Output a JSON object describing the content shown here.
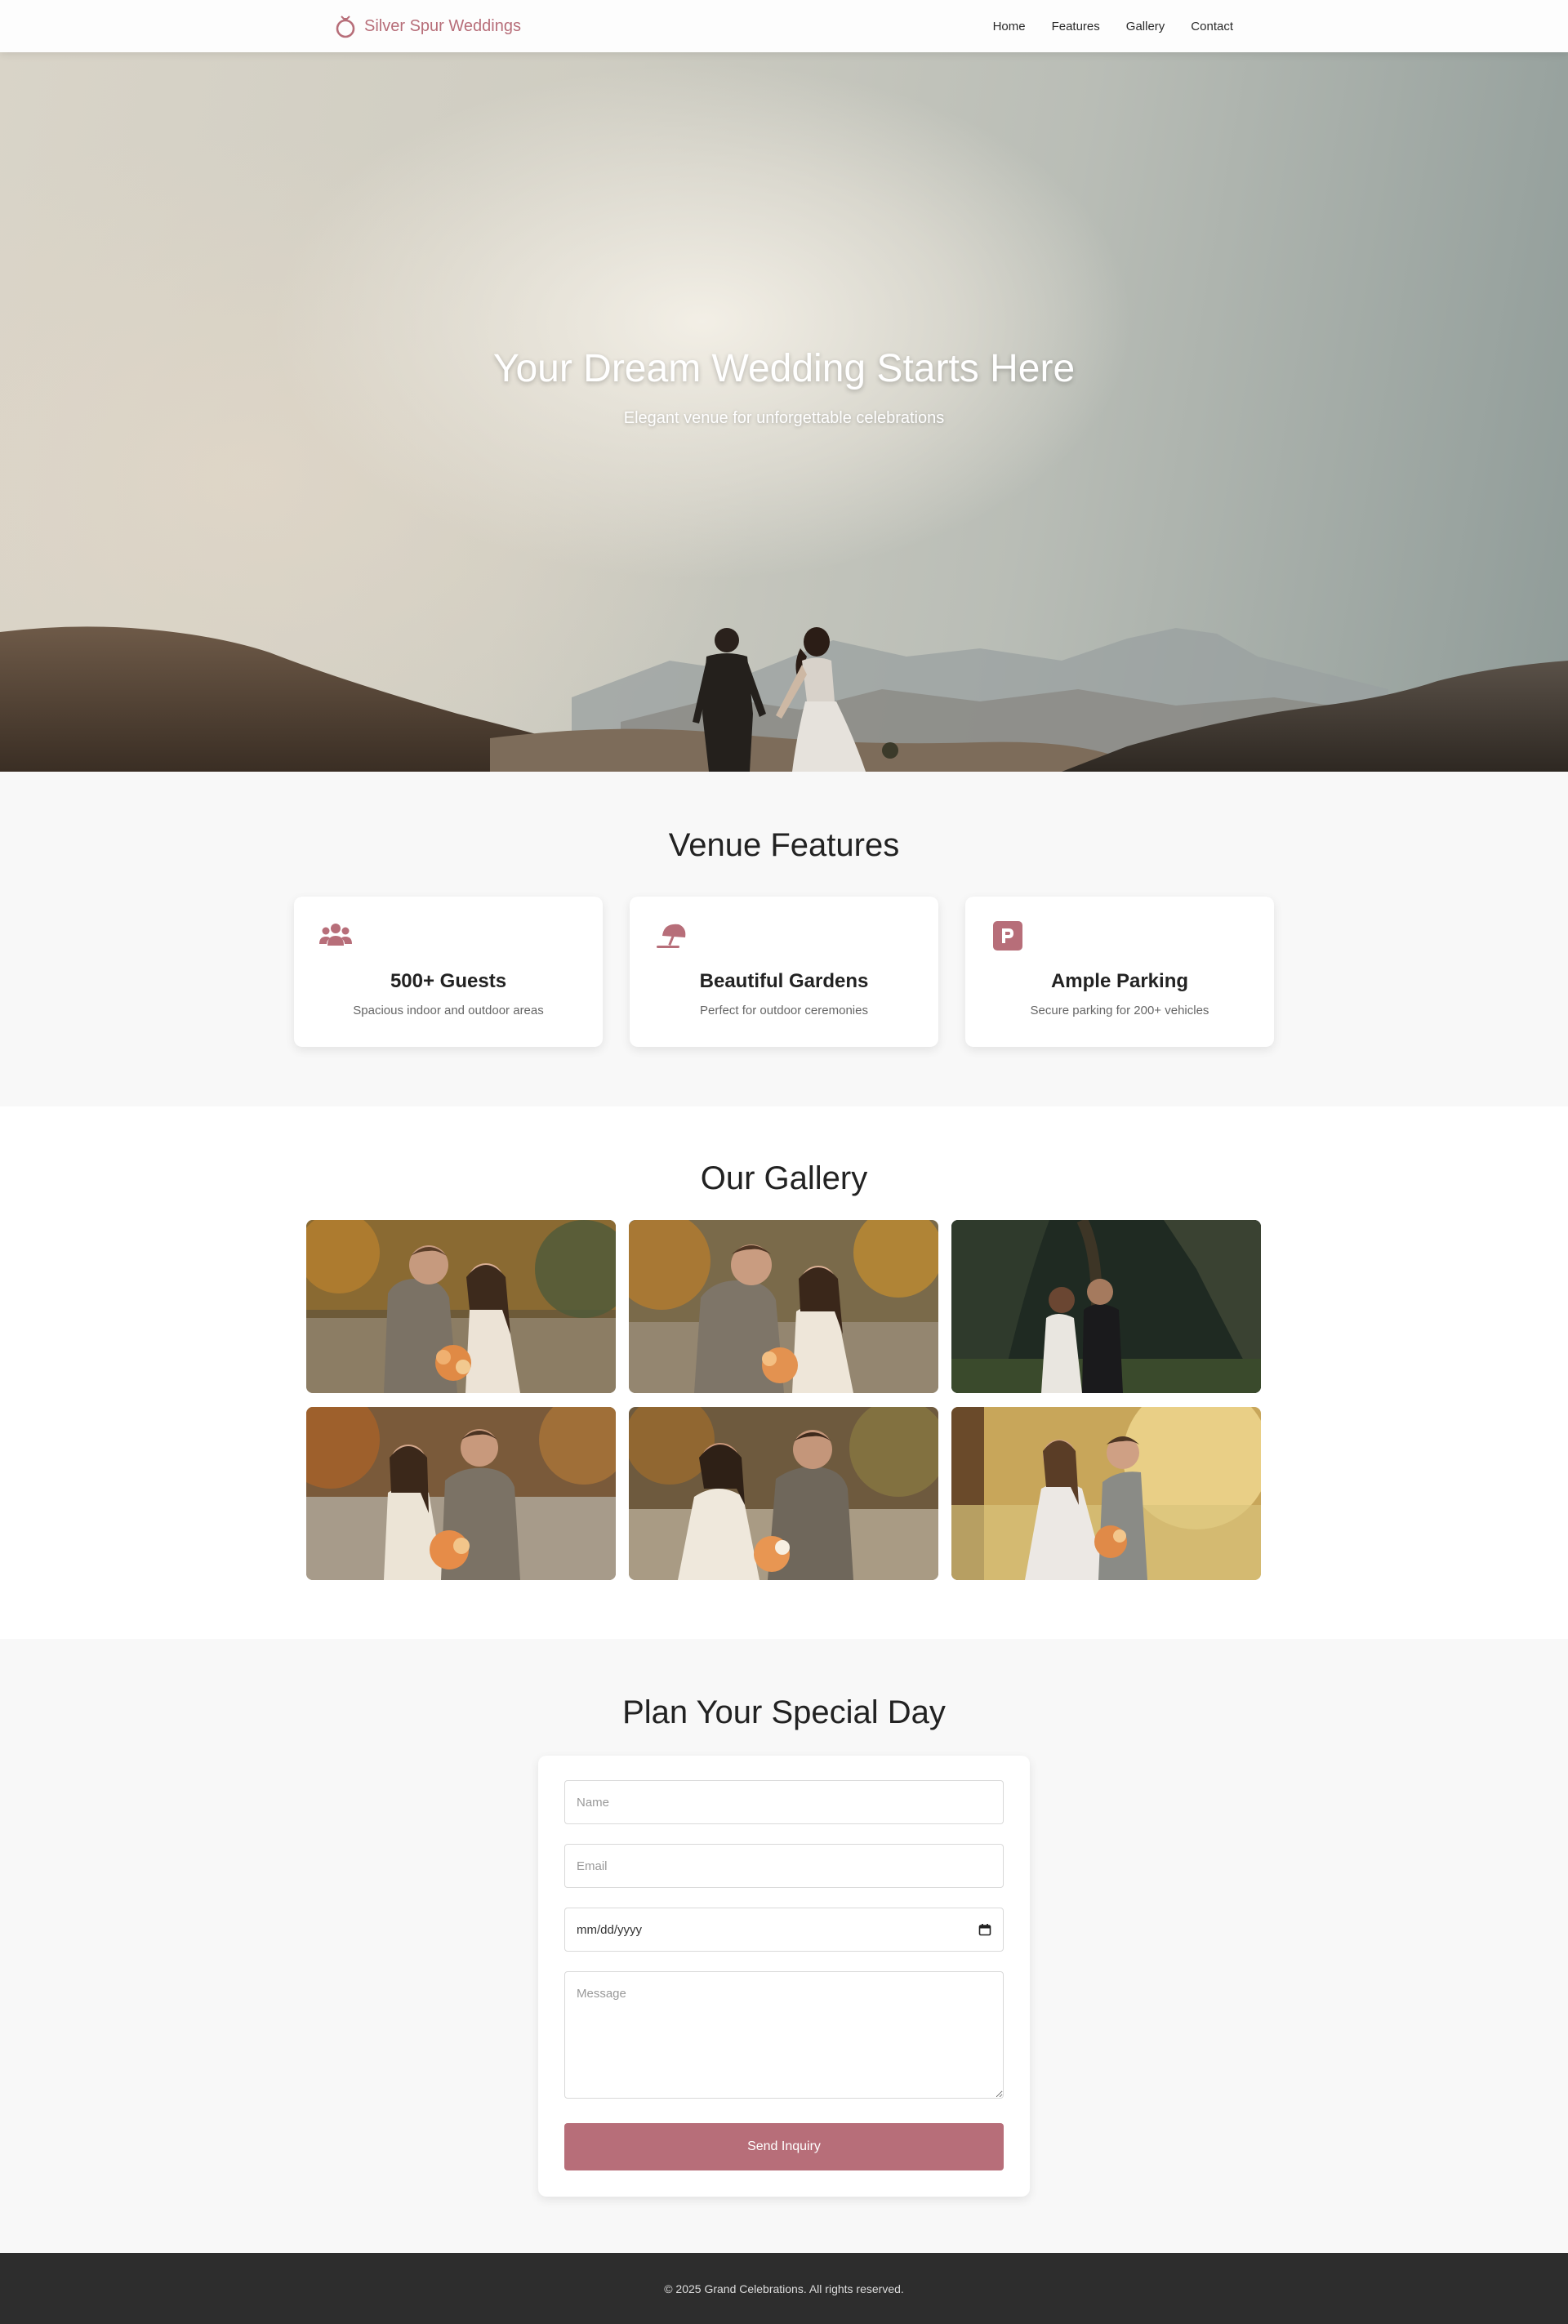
{
  "brand": {
    "name": "Silver Spur Weddings",
    "icon": "ring-icon",
    "accent_color": "#b76e79"
  },
  "nav": {
    "items": [
      {
        "label": "Home"
      },
      {
        "label": "Features"
      },
      {
        "label": "Gallery"
      },
      {
        "label": "Contact"
      }
    ]
  },
  "hero": {
    "title": "Your Dream Wedding Starts Here",
    "subtitle": "Elegant venue for unforgettable celebrations"
  },
  "features": {
    "title": "Venue Features",
    "items": [
      {
        "icon": "users-icon",
        "title": "500+ Guests",
        "description": "Spacious indoor and outdoor areas"
      },
      {
        "icon": "umbrella-beach-icon",
        "title": "Beautiful Gardens",
        "description": "Perfect for outdoor ceremonies"
      },
      {
        "icon": "parking-icon",
        "title": "Ample Parking",
        "description": "Secure parking for 200+ vehicles"
      }
    ]
  },
  "gallery": {
    "title": "Our Gallery",
    "photo_count": 6
  },
  "contact": {
    "title": "Plan Your Special Day",
    "name_placeholder": "Name",
    "email_placeholder": "Email",
    "date_value": "mm/dd/yyyy",
    "message_placeholder": "Message",
    "submit_label": "Send Inquiry"
  },
  "footer": {
    "text": "© 2025 Grand Celebrations. All rights reserved."
  }
}
